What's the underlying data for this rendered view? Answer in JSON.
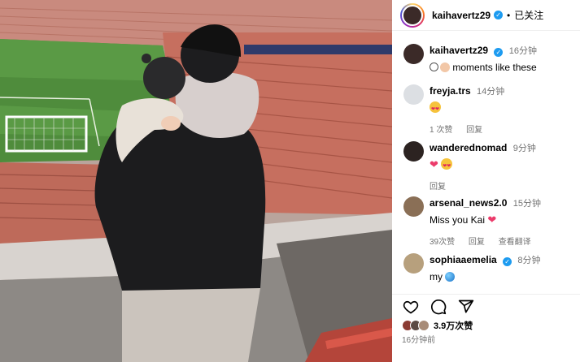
{
  "post": {
    "author": "kaihavertz29",
    "follow_state": "已关注",
    "separator": "•"
  },
  "comments": [
    {
      "user": "kaihavertz29",
      "time": "16分钟",
      "text": "moments like these",
      "emoji": "ball-baby",
      "verified": true,
      "meta": []
    },
    {
      "user": "freyja.trs",
      "time": "14分钟",
      "text": "",
      "emoji": "heart-eyes",
      "verified": false,
      "meta": [
        "1 次赞",
        "回复"
      ]
    },
    {
      "user": "wanderednomad",
      "time": "9分钟",
      "text": "",
      "emoji": "heart-heart-eyes",
      "verified": false,
      "meta": [
        "回复"
      ]
    },
    {
      "user": "arsenal_news2.0",
      "time": "15分钟",
      "text": "Miss you Kai",
      "emoji": "heart",
      "verified": false,
      "meta": [
        "39次赞",
        "回复",
        "查看翻译"
      ]
    },
    {
      "user": "sophiaaemelia",
      "time": "8分钟",
      "text": "my",
      "emoji": "globe",
      "verified": true,
      "meta": []
    }
  ],
  "actions": {
    "like_icon": "heart-icon",
    "comment_icon": "comment-icon",
    "share_icon": "share-icon",
    "likes_count": "3.9万次赞",
    "post_time": "16分钟前"
  },
  "colors": {
    "verified": "#1d9bf0",
    "meta_gray": "#737373",
    "stadium_seat": "#c86b5a",
    "pitch": "#4f8c3c"
  }
}
